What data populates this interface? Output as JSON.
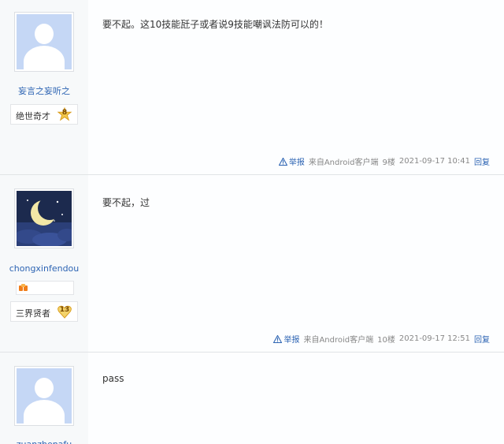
{
  "posts": [
    {
      "username": "妄言之妄听之",
      "badge": "绝世奇才",
      "level": "8",
      "content": "要不起。这10技能瓩子或者说9技能嘲讽法防可以的！",
      "report": "举报",
      "source": "来自Android客户端",
      "floor": "9楼",
      "time": "2021-09-17 10:41",
      "reply": "回复"
    },
    {
      "username": "chongxinfendou",
      "badge": "三界贤者",
      "level": "13",
      "content": "要不起，过",
      "report": "举报",
      "source": "来自Android客户端",
      "floor": "10楼",
      "time": "2021-09-17 12:51",
      "reply": "回复"
    },
    {
      "username": "zuanzhenafu",
      "content": "pass"
    }
  ],
  "colors": {
    "link": "#2d64b3",
    "sidebar_bg": "#f7f9fa",
    "level_badge": "#f3c84b"
  }
}
